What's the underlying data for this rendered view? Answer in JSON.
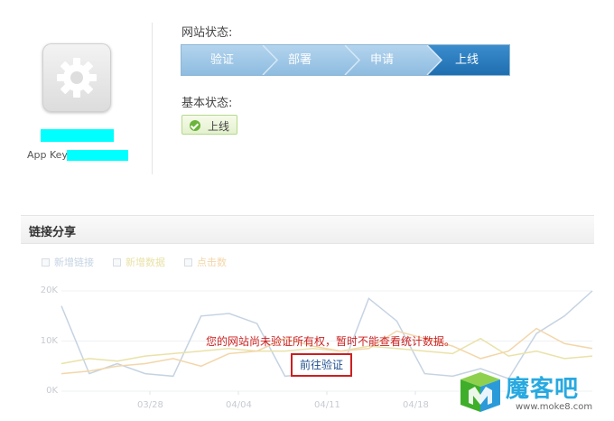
{
  "app": {
    "icon": "gear-icon",
    "app_key_label": "App Key:"
  },
  "site_status": {
    "label": "网站状态:",
    "steps": [
      "验证",
      "部署",
      "申请",
      "上线"
    ],
    "active_step": 4
  },
  "basic_status": {
    "label": "基本状态:",
    "badge_icon": "check-circle-icon",
    "badge_text": "上线"
  },
  "share": {
    "title": "链接分享",
    "legend": [
      {
        "name": "新增链接",
        "color": "#c5d3e2"
      },
      {
        "name": "新增数据",
        "color": "#e9e2a8"
      },
      {
        "name": "点击数",
        "color": "#f3d6a9"
      }
    ],
    "notice": "您的网站尚未验证所有权，暂时不能查看统计数据。",
    "verify_button": "前往验证"
  },
  "chart_data": {
    "type": "line",
    "x_tick_labels": [
      "03/28",
      "04/04",
      "04/11",
      "04/18"
    ],
    "y_tick_labels": [
      "20K",
      "10K",
      "0K"
    ],
    "ylim": [
      0,
      20000
    ],
    "grid": true,
    "series": [
      {
        "name": "新增链接",
        "color": "#c5d3e2",
        "values": [
          17000,
          3500,
          5500,
          3500,
          3000,
          15000,
          15500,
          13500,
          3000,
          3500,
          4000,
          18500,
          14000,
          3500,
          3000,
          4500,
          2500,
          11500,
          15000,
          20000
        ]
      },
      {
        "name": "新增数据",
        "color": "#e9e2a8",
        "values": [
          5500,
          6500,
          6000,
          7000,
          7500,
          8000,
          8500,
          8000,
          8000,
          8500,
          8000,
          9000,
          8500,
          8000,
          7500,
          10500,
          7000,
          8000,
          6500,
          7000
        ]
      },
      {
        "name": "点击数",
        "color": "#f3d6a9",
        "values": [
          3500,
          4000,
          5000,
          5500,
          6500,
          5000,
          7500,
          8000,
          10500,
          9000,
          8000,
          8500,
          12000,
          10500,
          9000,
          6500,
          8000,
          12500,
          9500,
          8500
        ]
      }
    ]
  },
  "watermark": {
    "text": "魔客吧",
    "url": "www.moke8.com"
  }
}
